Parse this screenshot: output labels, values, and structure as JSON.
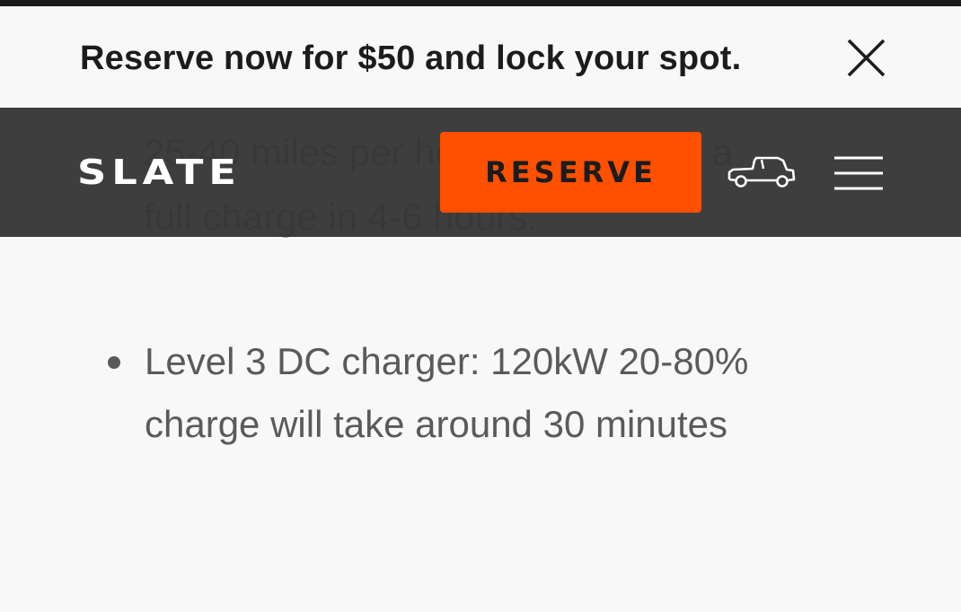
{
  "promo": {
    "text": "Reserve now for $50 and lock your spot."
  },
  "header": {
    "logo": "SLATE",
    "reserve_label": "RESERVE"
  },
  "content": {
    "partial_text": "25-40 miles per hour of charge or a full charge in 4-6 hours.",
    "bullets": [
      "Level 3 DC charger: 120kW 20-80% charge will take around 30 minutes"
    ]
  },
  "icons": {
    "close": "close-icon",
    "truck": "truck-icon",
    "menu": "hamburger-menu-icon"
  },
  "colors": {
    "accent": "#ff5000",
    "navbar": "#383838",
    "text": "#1c1c1c",
    "body_text": "#5a5a5a",
    "background": "#f8f8f8"
  }
}
